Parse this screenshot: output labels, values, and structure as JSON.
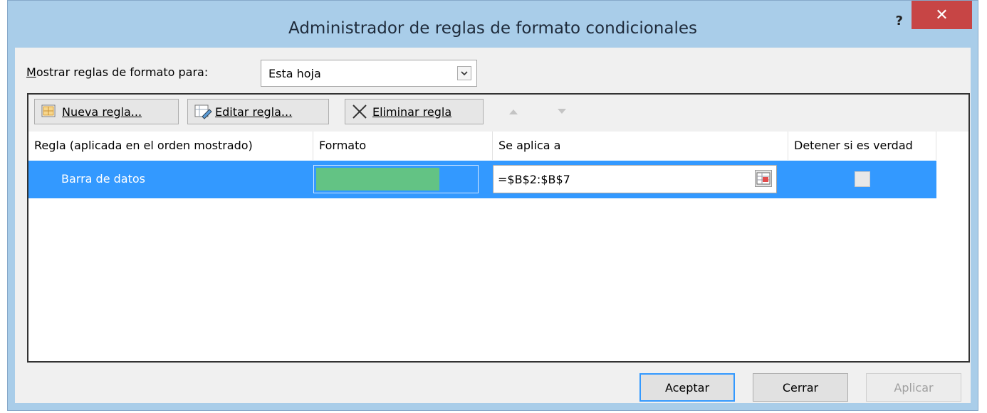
{
  "window": {
    "title": "Administrador de reglas de formato condicionales",
    "help_label": "?",
    "close_label": "✕",
    "close_color": "#c74545"
  },
  "show_rules": {
    "label_prefix": "M",
    "label_rest": "ostrar reglas de formato para:",
    "selected": "Esta hoja"
  },
  "toolbar": {
    "new_rule_label": "Nueva regla...",
    "edit_rule_label": "Editar regla...",
    "delete_rule_label": "Eliminar regla",
    "move_up_icon": "triangle-up-icon",
    "move_down_icon": "triangle-down-icon"
  },
  "table": {
    "headers": [
      "Regla (aplicada en el orden mostrado)",
      "Formato",
      "Se aplica a",
      "Detener si es verdad"
    ],
    "rows": [
      {
        "rule": "Barra de datos",
        "format_bar_color": "#63c384",
        "applies_to": "=$B$2:$B$7",
        "stop_if_true": false
      }
    ],
    "selected_row_color": "#3399ff"
  },
  "footer": {
    "ok_label": "Aceptar",
    "close_label": "Cerrar",
    "apply_label": "Aplicar"
  }
}
